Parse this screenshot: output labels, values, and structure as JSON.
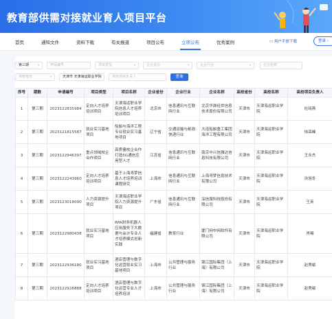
{
  "banner": {
    "title": "教育部供需对接就业育人项目平台"
  },
  "nav": {
    "items": [
      {
        "label": "首页"
      },
      {
        "label": "通知文件"
      },
      {
        "label": "资料下载"
      },
      {
        "label": "有关报道"
      },
      {
        "label": "项目公布"
      },
      {
        "label": "立项公布"
      },
      {
        "label": "优秀案例"
      }
    ],
    "active_index": 5,
    "manual_label": "用户手册下载",
    "login_label": "登录"
  },
  "filters": {
    "batch": "第三期",
    "app_no_placeholder": "申请编号",
    "type_placeholder": "项目类型",
    "ent_province_placeholder": "企业省份",
    "industry_placeholder": "企业行业",
    "ent_name_placeholder": "企业名称",
    "school_province": "天津市",
    "school_name": "天津海运职业学院",
    "leader_placeholder": "高校项目负责人",
    "query_label": "查询",
    "school_province_placeholder": "高校省份"
  },
  "table": {
    "headers": [
      "序号",
      "期数",
      "申请编号",
      "项目类型",
      "项目名称",
      "企业省份",
      "企业行业",
      "企业名称",
      "高校省份",
      "高校名称",
      "高校项目负责人"
    ],
    "rows": [
      [
        "1",
        "第三期",
        "2023122835984",
        "定向人才培养培训项目",
        "天津海运职业学院信息人才培养培训项目",
        "北京市",
        "信息通讯与互联网行业",
        "北京华晟经世信息技术股份有限公司",
        "天津市",
        "天津海运职业学院",
        "杜晓燕"
      ],
      [
        "2",
        "第三期",
        "2023121815587",
        "就业实习基地项目",
        "船舶与海洋工程专业就业实习基地项目",
        "辽宁省",
        "交通运输与邮政快递行业",
        "大连船舶重工集团海洋工程有限公司",
        "天津市",
        "天津海运职业学院",
        "徐高峰"
      ],
      [
        "3",
        "第三期",
        "2023122946397",
        "重点领域校企合作项目",
        "高质量校企合作打造5G通信应用型人才",
        "江苏省",
        "信息通讯与互联网行业",
        "南京中兴信雅达信息科技有限公司",
        "天津市",
        "天津海运职业学院",
        "王永杰"
      ],
      [
        "4",
        "第三期",
        "2023122243960",
        "定向人才培养培训项目",
        "基于上海寻梦信息人才培养培训课程研究",
        "上海市",
        "信息通讯与互联网行业",
        "上海寻梦信息技术有限公司",
        "天津市",
        "天津海运职业学院",
        "许旭冬"
      ],
      [
        "5",
        "第三期",
        "2023123018090",
        "人力资源提升项目",
        "天津海运职业学院人力资源提升项目",
        "广东省",
        "信息通讯与互联网行业",
        "深信服科技股份有限公司",
        "天津市",
        "天津海运职业学院",
        "王英"
      ],
      [
        "6",
        "第三期",
        "2023122980438",
        "就业实习基地项目",
        "RPA财务机器人应用服务下大数据与会计专业人才培养模式创新实践",
        "福建省",
        "教育行业",
        "厦门网中网软件有限公司",
        "天津市",
        "天津海运职业学院",
        "肖曦"
      ],
      [
        "7",
        "第三期",
        "2023122936180",
        "就业实习基地项目",
        "酒店管理与数字化运营就业实习基地项目",
        "上海市",
        "公共管理与服务行业",
        "锦江国际集团（上海）有限公司",
        "天津市",
        "天津海运职业学院",
        "赵秀颖"
      ],
      [
        "8",
        "第三期",
        "2023122926888",
        "定向人才培养培训项目",
        "酒店管理与数字化运营专业人才培养培训",
        "上海市",
        "公共管理与服务行业",
        "锦江国际集团（上海）有限公司",
        "天津市",
        "天津海运职业学院",
        "赵秀颖"
      ]
    ]
  },
  "colors": {
    "accent": "#2f6fe4",
    "banner_start": "#2a6ee8",
    "banner_end": "#5aa8fb"
  }
}
